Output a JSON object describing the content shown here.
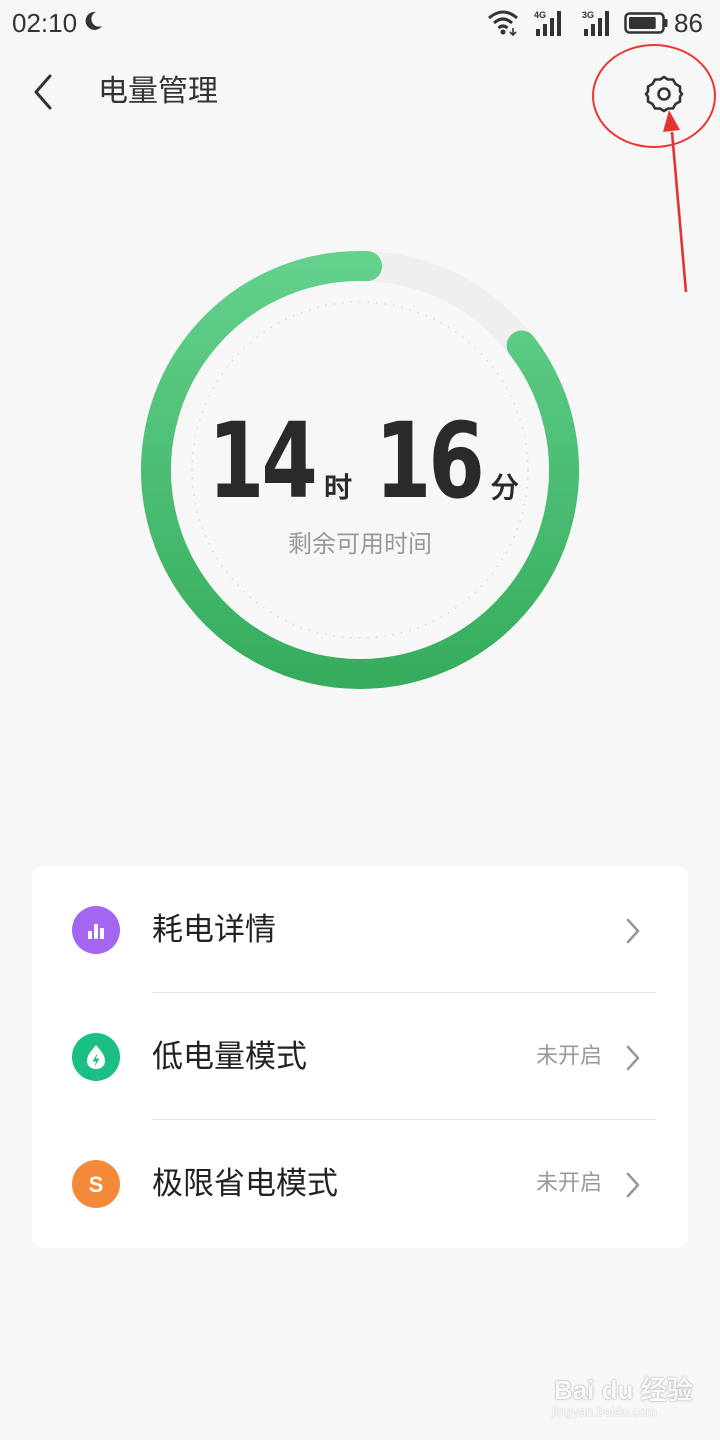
{
  "status_bar": {
    "time": "02:10",
    "battery_level": "86",
    "network_1": "4G",
    "network_2": "3G",
    "icons": [
      "moon-icon",
      "wifi-icon",
      "signal-4g-icon",
      "signal-3g-icon",
      "battery-icon"
    ]
  },
  "header": {
    "title": "电量管理",
    "back_icon": "chevron-left-icon",
    "settings_icon": "gear-icon"
  },
  "remaining": {
    "hours": "14",
    "hours_unit": "时",
    "minutes": "16",
    "minutes_unit": "分",
    "caption": "剩余可用时间",
    "battery_fraction": 0.86
  },
  "menu": {
    "items": [
      {
        "label": "耗电详情",
        "status": "",
        "icon": "bar-chart-icon",
        "color": "#a466f0"
      },
      {
        "label": "低电量模式",
        "status": "未开启",
        "icon": "leaf-bolt-icon",
        "color": "#1bbf83"
      },
      {
        "label": "极限省电模式",
        "status": "未开启",
        "icon": "s-letter-icon",
        "icon_text": "S",
        "color": "#f5893a"
      }
    ]
  },
  "colors": {
    "ring_green_light": "#63d08b",
    "ring_green_dark": "#36ad5e",
    "ring_track": "#efefef",
    "annotation": "#e33333"
  },
  "watermark": {
    "brand": "Bai du 经验",
    "url": "jingyan.baidu.com"
  }
}
